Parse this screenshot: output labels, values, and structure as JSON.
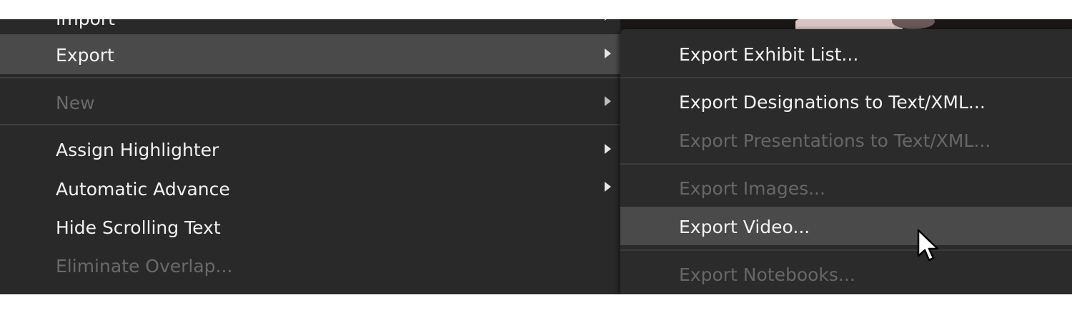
{
  "main_menu": {
    "items": [
      {
        "label": "Import",
        "state": "normal",
        "submenu": true
      },
      {
        "label": "Export",
        "state": "highlighted",
        "submenu": true
      },
      {
        "label": "New",
        "state": "disabled",
        "submenu": true
      },
      {
        "label": "Assign Highlighter",
        "state": "normal",
        "submenu": true
      },
      {
        "label": "Automatic Advance",
        "state": "normal",
        "submenu": true
      },
      {
        "label": "Hide Scrolling Text",
        "state": "normal",
        "submenu": false
      },
      {
        "label": "Eliminate Overlap...",
        "state": "disabled",
        "submenu": false
      }
    ]
  },
  "export_submenu": {
    "items": [
      {
        "label": "Export Exhibit List...",
        "state": "normal"
      },
      {
        "label": "Export Designations to Text/XML...",
        "state": "normal"
      },
      {
        "label": "Export Presentations to Text/XML...",
        "state": "disabled"
      },
      {
        "label": "Export Images...",
        "state": "disabled"
      },
      {
        "label": "Export Video...",
        "state": "highlighted"
      },
      {
        "label": "Export Notebooks...",
        "state": "disabled"
      }
    ]
  },
  "icons": {
    "submenu_arrow": "chevron-right-icon",
    "cursor": "mouse-pointer-icon"
  },
  "colors": {
    "menu_bg": "#292929",
    "highlight_bg": "#4a4a4a",
    "text": "#f2f2f2",
    "disabled_text": "#6a6a6a"
  }
}
